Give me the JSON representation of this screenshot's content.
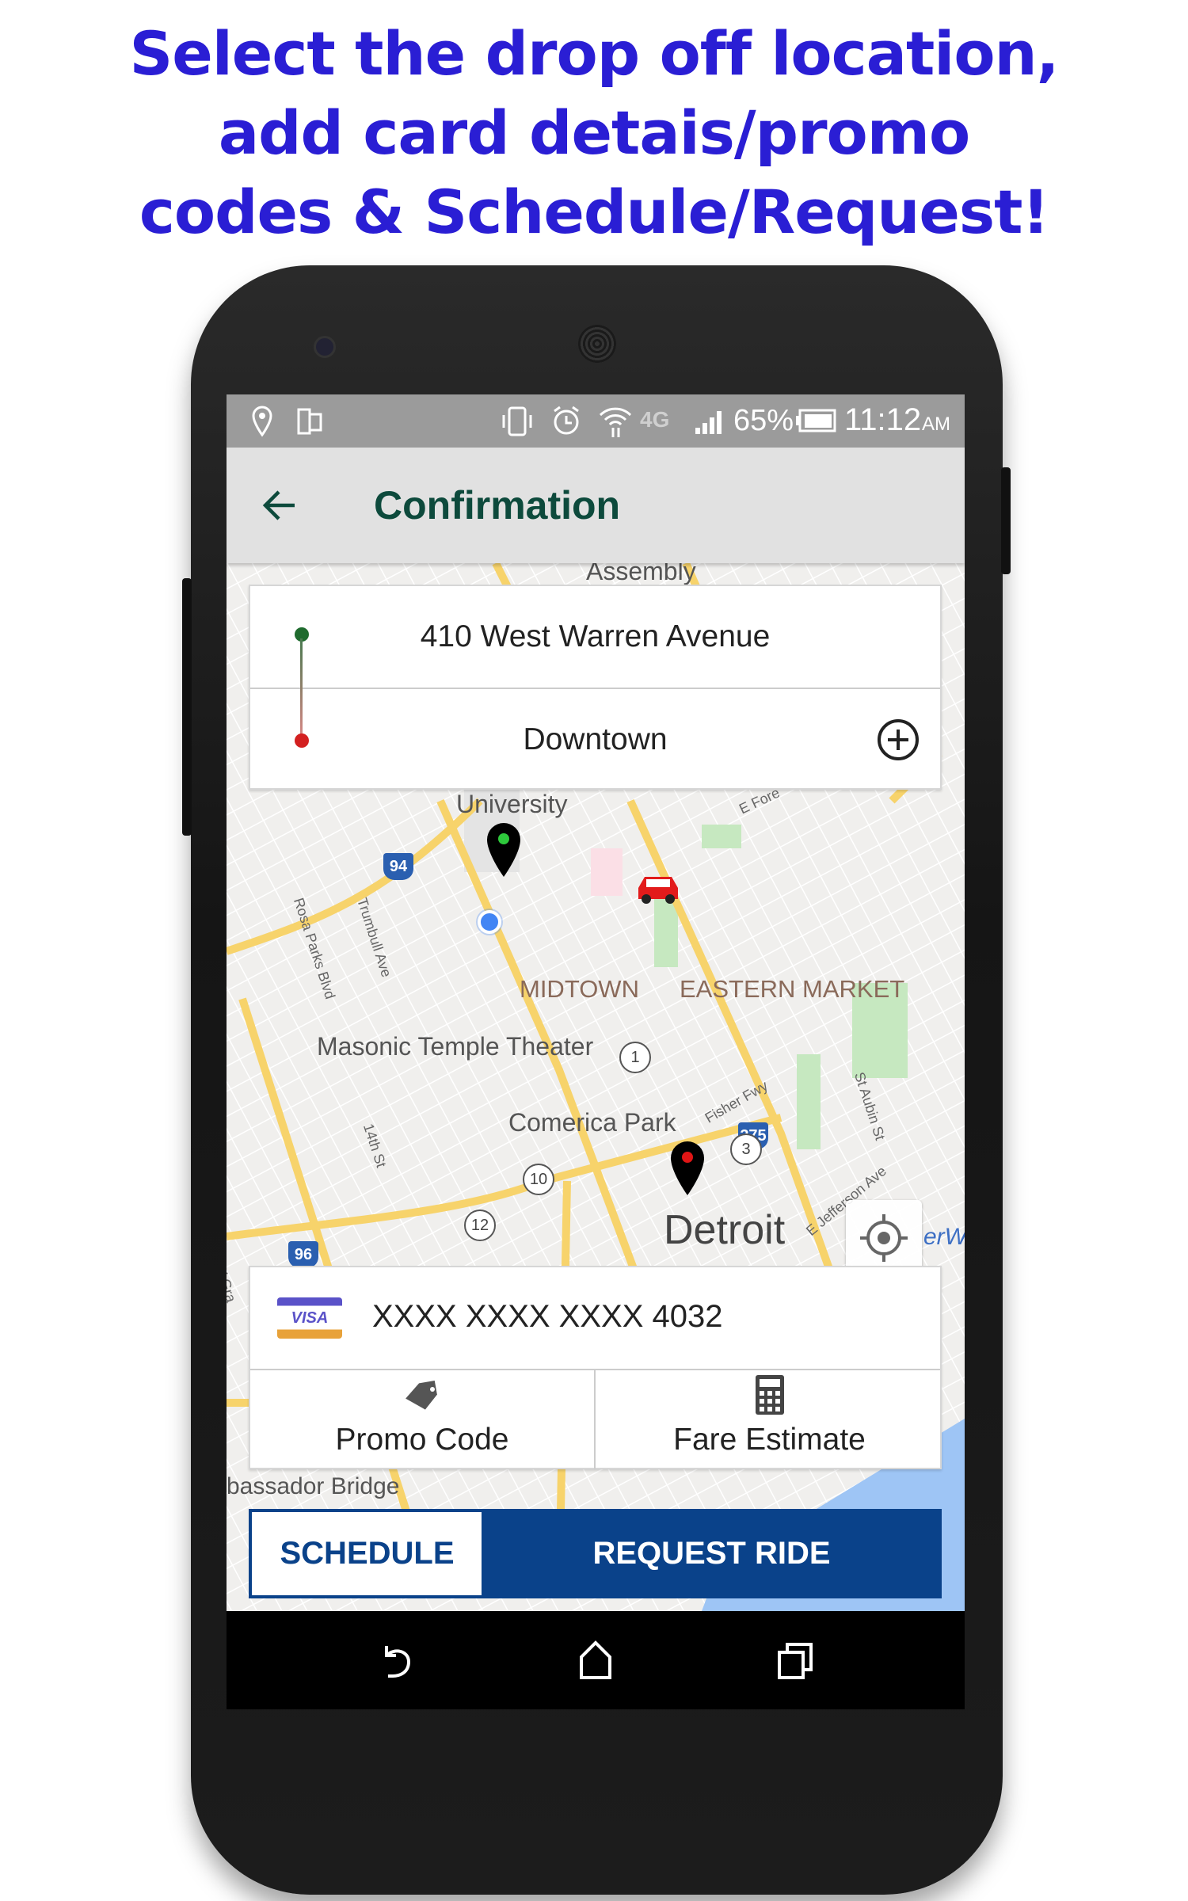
{
  "headline": [
    "Select the drop off location,",
    "add card detais/promo",
    "codes & Schedule/Request!"
  ],
  "status_bar": {
    "battery": "65%",
    "time": "11:12",
    "ampm": "AM",
    "network": "4G"
  },
  "app_bar": {
    "title": "Confirmation",
    "back_icon": "arrow-left-icon"
  },
  "route": {
    "pickup": "410 West Warren Avenue",
    "dropoff": "Downtown",
    "pickup_color": "#1f6b2e",
    "dropoff_color": "#d32020"
  },
  "map": {
    "places": [
      "Assembly",
      "University",
      "MIDTOWN",
      "EASTERN MARKET",
      "Masonic Temple Theater",
      "Comerica Park",
      "Detroit"
    ],
    "streets": [
      "Rosa Parks Blvd",
      "Trumbull Ave",
      "14th St",
      "Fisher Fwy",
      "St Aubin St",
      "E Jefferson Ave",
      "E Fore",
      "W Gra",
      "erW"
    ],
    "shields": [
      "94",
      "375",
      "96",
      "75"
    ],
    "routes": [
      "10",
      "12",
      "1",
      "3"
    ],
    "partial_label": "bassador Bridge"
  },
  "payment": {
    "card_brand": "VISA",
    "card_number": "XXXX XXXX XXXX 4032"
  },
  "actions": {
    "promo": "Promo Code",
    "fare": "Fare Estimate"
  },
  "buttons": {
    "schedule": "SCHEDULE",
    "request": "REQUEST RIDE"
  },
  "colors": {
    "headline": "#2a1ed4",
    "title": "#0d4a3c",
    "primary": "#0a428a"
  }
}
